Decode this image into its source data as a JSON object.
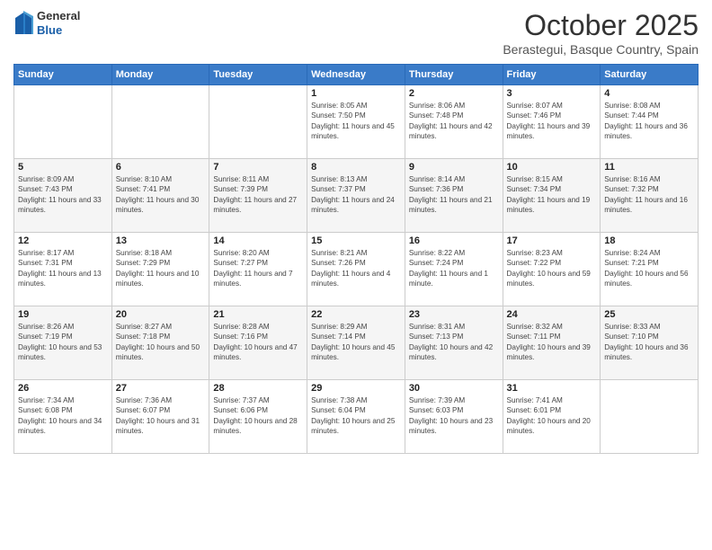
{
  "header": {
    "logo_general": "General",
    "logo_blue": "Blue",
    "month_title": "October 2025",
    "location": "Berastegui, Basque Country, Spain"
  },
  "weekdays": [
    "Sunday",
    "Monday",
    "Tuesday",
    "Wednesday",
    "Thursday",
    "Friday",
    "Saturday"
  ],
  "weeks": [
    [
      {
        "day": "",
        "empty": true
      },
      {
        "day": "",
        "empty": true
      },
      {
        "day": "",
        "empty": true
      },
      {
        "day": "1",
        "sunrise": "8:05 AM",
        "sunset": "7:50 PM",
        "daylight": "11 hours and 45 minutes."
      },
      {
        "day": "2",
        "sunrise": "8:06 AM",
        "sunset": "7:48 PM",
        "daylight": "11 hours and 42 minutes."
      },
      {
        "day": "3",
        "sunrise": "8:07 AM",
        "sunset": "7:46 PM",
        "daylight": "11 hours and 39 minutes."
      },
      {
        "day": "4",
        "sunrise": "8:08 AM",
        "sunset": "7:44 PM",
        "daylight": "11 hours and 36 minutes."
      }
    ],
    [
      {
        "day": "5",
        "sunrise": "8:09 AM",
        "sunset": "7:43 PM",
        "daylight": "11 hours and 33 minutes."
      },
      {
        "day": "6",
        "sunrise": "8:10 AM",
        "sunset": "7:41 PM",
        "daylight": "11 hours and 30 minutes."
      },
      {
        "day": "7",
        "sunrise": "8:11 AM",
        "sunset": "7:39 PM",
        "daylight": "11 hours and 27 minutes."
      },
      {
        "day": "8",
        "sunrise": "8:13 AM",
        "sunset": "7:37 PM",
        "daylight": "11 hours and 24 minutes."
      },
      {
        "day": "9",
        "sunrise": "8:14 AM",
        "sunset": "7:36 PM",
        "daylight": "11 hours and 21 minutes."
      },
      {
        "day": "10",
        "sunrise": "8:15 AM",
        "sunset": "7:34 PM",
        "daylight": "11 hours and 19 minutes."
      },
      {
        "day": "11",
        "sunrise": "8:16 AM",
        "sunset": "7:32 PM",
        "daylight": "11 hours and 16 minutes."
      }
    ],
    [
      {
        "day": "12",
        "sunrise": "8:17 AM",
        "sunset": "7:31 PM",
        "daylight": "11 hours and 13 minutes."
      },
      {
        "day": "13",
        "sunrise": "8:18 AM",
        "sunset": "7:29 PM",
        "daylight": "11 hours and 10 minutes."
      },
      {
        "day": "14",
        "sunrise": "8:20 AM",
        "sunset": "7:27 PM",
        "daylight": "11 hours and 7 minutes."
      },
      {
        "day": "15",
        "sunrise": "8:21 AM",
        "sunset": "7:26 PM",
        "daylight": "11 hours and 4 minutes."
      },
      {
        "day": "16",
        "sunrise": "8:22 AM",
        "sunset": "7:24 PM",
        "daylight": "11 hours and 1 minute."
      },
      {
        "day": "17",
        "sunrise": "8:23 AM",
        "sunset": "7:22 PM",
        "daylight": "10 hours and 59 minutes."
      },
      {
        "day": "18",
        "sunrise": "8:24 AM",
        "sunset": "7:21 PM",
        "daylight": "10 hours and 56 minutes."
      }
    ],
    [
      {
        "day": "19",
        "sunrise": "8:26 AM",
        "sunset": "7:19 PM",
        "daylight": "10 hours and 53 minutes."
      },
      {
        "day": "20",
        "sunrise": "8:27 AM",
        "sunset": "7:18 PM",
        "daylight": "10 hours and 50 minutes."
      },
      {
        "day": "21",
        "sunrise": "8:28 AM",
        "sunset": "7:16 PM",
        "daylight": "10 hours and 47 minutes."
      },
      {
        "day": "22",
        "sunrise": "8:29 AM",
        "sunset": "7:14 PM",
        "daylight": "10 hours and 45 minutes."
      },
      {
        "day": "23",
        "sunrise": "8:31 AM",
        "sunset": "7:13 PM",
        "daylight": "10 hours and 42 minutes."
      },
      {
        "day": "24",
        "sunrise": "8:32 AM",
        "sunset": "7:11 PM",
        "daylight": "10 hours and 39 minutes."
      },
      {
        "day": "25",
        "sunrise": "8:33 AM",
        "sunset": "7:10 PM",
        "daylight": "10 hours and 36 minutes."
      }
    ],
    [
      {
        "day": "26",
        "sunrise": "7:34 AM",
        "sunset": "6:08 PM",
        "daylight": "10 hours and 34 minutes."
      },
      {
        "day": "27",
        "sunrise": "7:36 AM",
        "sunset": "6:07 PM",
        "daylight": "10 hours and 31 minutes."
      },
      {
        "day": "28",
        "sunrise": "7:37 AM",
        "sunset": "6:06 PM",
        "daylight": "10 hours and 28 minutes."
      },
      {
        "day": "29",
        "sunrise": "7:38 AM",
        "sunset": "6:04 PM",
        "daylight": "10 hours and 25 minutes."
      },
      {
        "day": "30",
        "sunrise": "7:39 AM",
        "sunset": "6:03 PM",
        "daylight": "10 hours and 23 minutes."
      },
      {
        "day": "31",
        "sunrise": "7:41 AM",
        "sunset": "6:01 PM",
        "daylight": "10 hours and 20 minutes."
      },
      {
        "day": "",
        "empty": true
      }
    ]
  ]
}
